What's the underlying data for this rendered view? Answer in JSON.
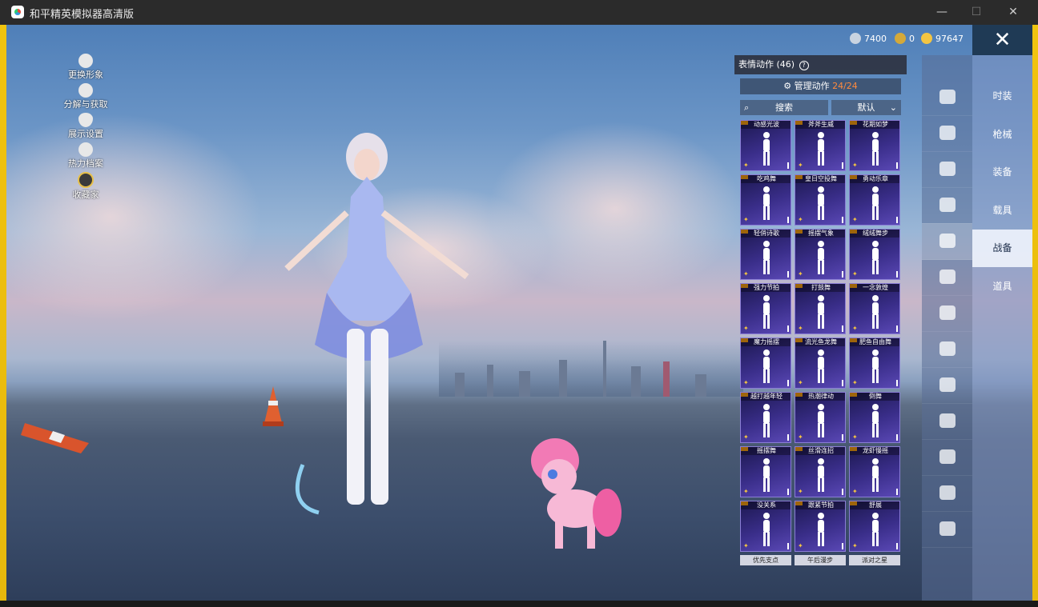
{
  "window": {
    "title": "和平精英模拟器高清版",
    "minimize": "—",
    "maximize": "☐",
    "close": "✕"
  },
  "left_menu": [
    {
      "label": "更换形象",
      "icon": "avatar-icon"
    },
    {
      "label": "分解与获取",
      "icon": "puzzle-icon"
    },
    {
      "label": "展示设置",
      "icon": "eye-icon"
    },
    {
      "label": "热力档案",
      "icon": "flame-icon"
    },
    {
      "label": "收藏家",
      "icon": "collector-badge-icon"
    }
  ],
  "currency": [
    {
      "value": "7400",
      "icon": "silver-coin-icon",
      "color": "#c9d3e0"
    },
    {
      "value": "0",
      "icon": "gold-coin-icon",
      "color": "#d4a93a"
    },
    {
      "value": "97647",
      "icon": "yellow-coin-icon",
      "color": "#f4c542"
    }
  ],
  "panel": {
    "title": "表情动作 (46)",
    "help": "?",
    "manage_label": "管理动作",
    "manage_count": "24/24",
    "search_label": "搜索",
    "sort_label": "默认"
  },
  "emotes": [
    "动感光波",
    "斧斧生威",
    "花期如梦",
    "吃鸡舞",
    "皇日空投舞",
    "勇动乐章",
    "轻俏诗歌",
    "摇摆气象",
    "绒绒舞步",
    "强力节拍",
    "打鼓舞",
    "一念敦煌",
    "魔力摇摆",
    "流光鱼龙舞",
    "肥鱼自由舞",
    "越打越年轻",
    "热潮律动",
    "倒舞",
    "摇摆舞",
    "丝滑连招",
    "龙虾慢摇",
    "没关系",
    "跟紧节拍",
    "舒展"
  ],
  "emote_bottom_labels": [
    "优先支点",
    "午后漫步",
    "派对之星"
  ],
  "rail_icons": [
    "parachute-icon",
    "hat-icon",
    "gun-icon",
    "plane-icon",
    "emote-icon",
    "robot-icon",
    "speaker-icon",
    "console-icon",
    "image-icon",
    "extinguisher-icon",
    "hand-icon",
    "wand-icon",
    "cloche-icon"
  ],
  "categories": [
    "时装",
    "枪械",
    "装备",
    "载具",
    "战备",
    "道具"
  ],
  "active_category": "战备",
  "colors": {
    "accent_orange": "#ff8a3d",
    "card_purple": "#3a2e8a",
    "frame_yellow": "#f1c40f"
  }
}
